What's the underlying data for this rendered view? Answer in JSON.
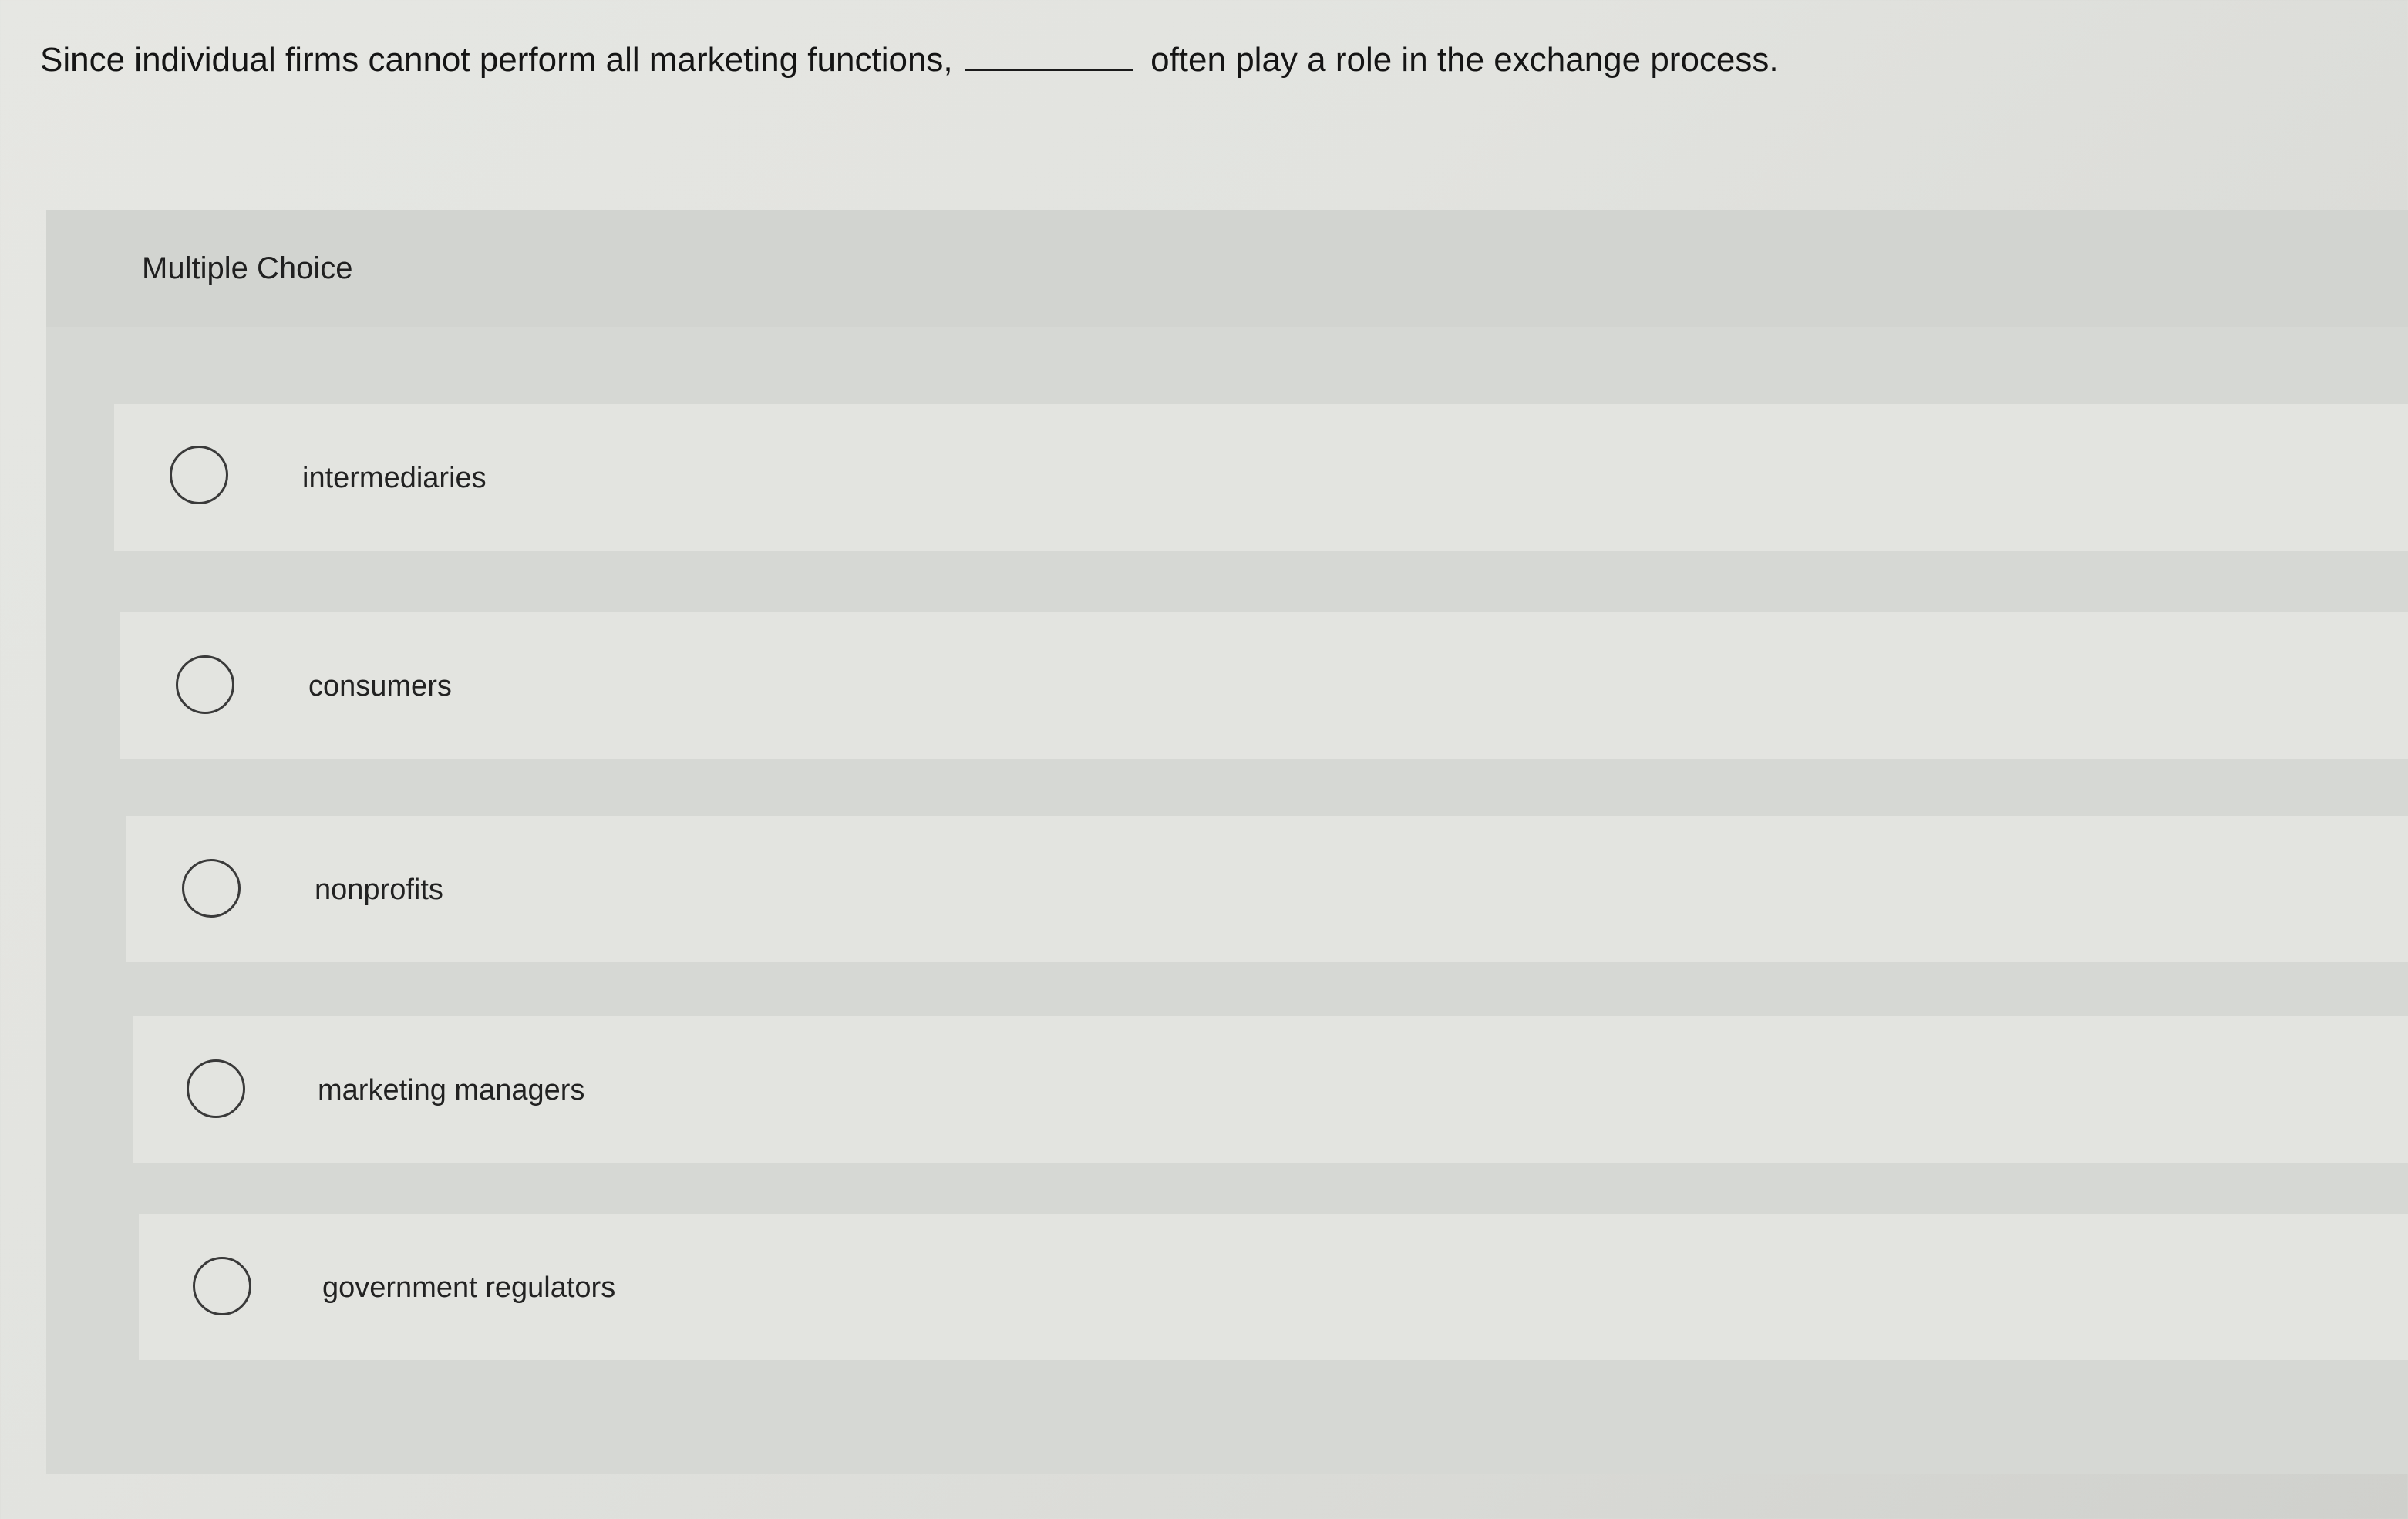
{
  "question": {
    "text_before": "Since individual firms cannot perform all marketing functions,",
    "text_after": "often play a role in the exchange process."
  },
  "multiple_choice": {
    "title": "Multiple Choice",
    "options": [
      {
        "label": "intermediaries",
        "selected": false
      },
      {
        "label": "consumers",
        "selected": false
      },
      {
        "label": "nonprofits",
        "selected": false
      },
      {
        "label": "marketing managers",
        "selected": false
      },
      {
        "label": "government regulators",
        "selected": false
      }
    ]
  }
}
